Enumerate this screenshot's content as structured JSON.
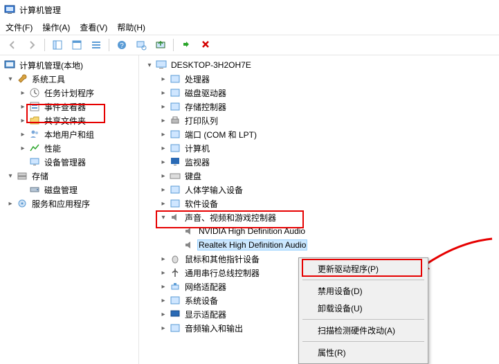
{
  "title": "计算机管理",
  "menus": [
    "文件(F)",
    "操作(A)",
    "查看(V)",
    "帮助(H)"
  ],
  "left_tree": {
    "root": {
      "label": "计算机管理(本地)",
      "icon": "computer-manage-icon",
      "expanded": true
    },
    "system_tools": {
      "label": "系统工具",
      "icon": "wrench-icon",
      "expanded": true
    },
    "task_scheduler": {
      "label": "任务计划程序",
      "icon": "clock-icon"
    },
    "event_viewer": {
      "label": "事件查看器",
      "icon": "event-icon"
    },
    "shared_folders": {
      "label": "共享文件夹",
      "icon": "shared-folders-icon"
    },
    "local_users": {
      "label": "本地用户和组",
      "icon": "users-icon"
    },
    "performance": {
      "label": "性能",
      "icon": "performance-icon"
    },
    "device_manager": {
      "label": "设备管理器",
      "icon": "device-manager-icon"
    },
    "storage": {
      "label": "存储",
      "icon": "storage-icon",
      "expanded": true
    },
    "disk_management": {
      "label": "磁盘管理",
      "icon": "disk-icon"
    },
    "services_apps": {
      "label": "服务和应用程序",
      "icon": "services-icon"
    }
  },
  "right_tree": {
    "root": {
      "label": "DESKTOP-3H2OH7E",
      "icon": "pc-icon",
      "expanded": true
    },
    "items": [
      {
        "label": "处理器",
        "icon": "cpu-icon"
      },
      {
        "label": "磁盘驱动器",
        "icon": "disk-drive-icon"
      },
      {
        "label": "存储控制器",
        "icon": "storage-ctrl-icon"
      },
      {
        "label": "打印队列",
        "icon": "printer-icon"
      },
      {
        "label": "端口 (COM 和 LPT)",
        "icon": "port-icon"
      },
      {
        "label": "计算机",
        "icon": "computer-icon"
      },
      {
        "label": "监视器",
        "icon": "monitor-icon"
      },
      {
        "label": "键盘",
        "icon": "keyboard-icon"
      },
      {
        "label": "人体学输入设备",
        "icon": "hid-icon"
      },
      {
        "label": "软件设备",
        "icon": "software-icon"
      }
    ],
    "sound": {
      "label": "声音、视频和游戏控制器",
      "icon": "sound-icon",
      "expanded": true
    },
    "sound_children": [
      {
        "label": "NVIDIA High Definition Audio",
        "icon": "speaker-icon"
      },
      {
        "label": "Realtek High Definition Audio",
        "icon": "speaker-icon",
        "selected": true
      }
    ],
    "after": [
      {
        "label": "鼠标和其他指针设备",
        "icon": "mouse-icon"
      },
      {
        "label": "通用串行总线控制器",
        "icon": "usb-icon"
      },
      {
        "label": "网络适配器",
        "icon": "network-icon"
      },
      {
        "label": "系统设备",
        "icon": "system-icon"
      },
      {
        "label": "显示适配器",
        "icon": "display-icon"
      },
      {
        "label": "音频输入和输出",
        "icon": "audio-io-icon"
      }
    ]
  },
  "context_menu": {
    "update": "更新驱动程序(P)",
    "disable": "禁用设备(D)",
    "uninstall": "卸载设备(U)",
    "scan": "扫描检测硬件改动(A)",
    "properties": "属性(R)"
  }
}
